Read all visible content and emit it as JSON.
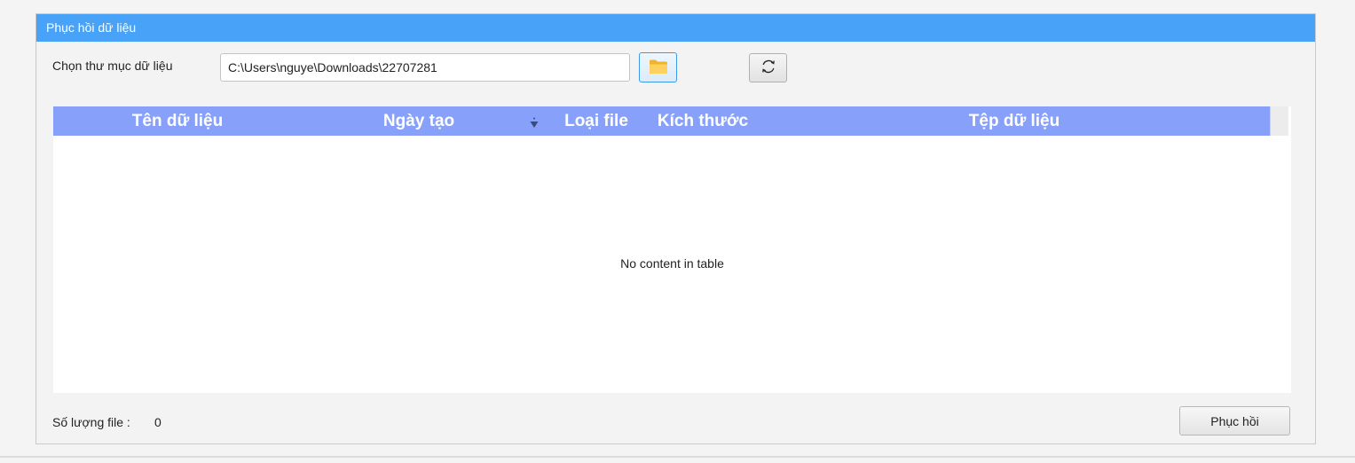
{
  "panel": {
    "title": "Phục hồi dữ liệu"
  },
  "folder": {
    "label": "Chọn thư mục dữ liệu",
    "path_value": "C:\\Users\\nguye\\Downloads\\22707281",
    "browse_icon": "folder-icon",
    "refresh_icon": "refresh-icon"
  },
  "table": {
    "columns": [
      "Tên dữ liệu",
      "Ngày tạo",
      "Loại file",
      "Kích thước",
      "Tệp dữ liệu"
    ],
    "sort_column": "Ngày tạo",
    "sort_direction": "descending",
    "rows": [],
    "empty_message": "No content in table"
  },
  "footer": {
    "count_label": "Số lượng file :",
    "count_value": "0",
    "restore_label": "Phục hồi"
  },
  "colors": {
    "header_bar": "#47a2f8",
    "table_header": "#87a1fb"
  }
}
